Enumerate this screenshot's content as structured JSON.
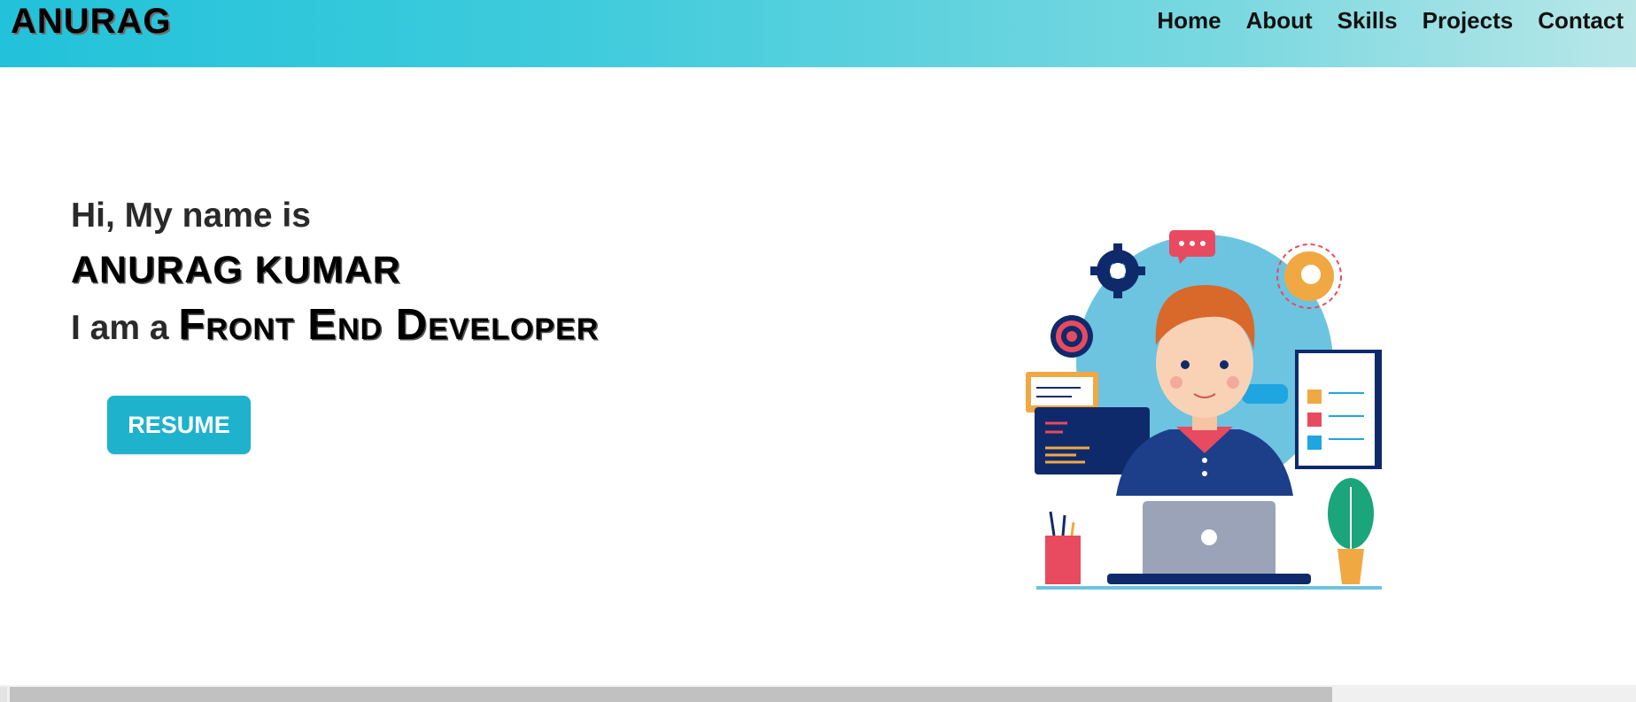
{
  "nav": {
    "logo": "ANURAG",
    "links": [
      "Home",
      "About",
      "Skills",
      "Projects",
      "Contact"
    ]
  },
  "hero": {
    "greeting": "Hi, My name is",
    "name": "ANURAG KUMAR",
    "role_prefix": "I am a ",
    "role": "Front End Developer",
    "button_label": "RESUME"
  },
  "icons": [
    "developer-illustration",
    "gear-icon",
    "chat-bubble-icon",
    "target-icon",
    "code-window-icon",
    "checklist-icon",
    "plant-icon",
    "pencil-cup-icon",
    "laptop-icon"
  ],
  "colors": {
    "nav_gradient_start": "#22c2da",
    "nav_gradient_end": "#b9e7e8",
    "button_bg": "#1fb2cc",
    "button_text": "#ffffff"
  }
}
